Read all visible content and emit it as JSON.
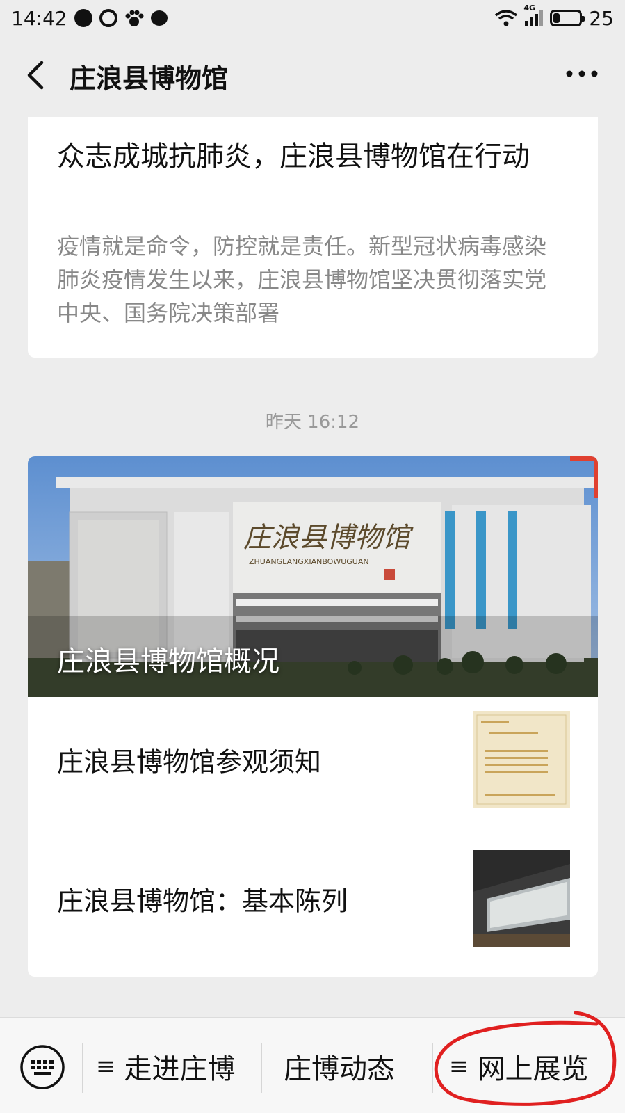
{
  "status_bar": {
    "time": "14:42",
    "left_icons": [
      "message-bubble-icon",
      "app-icon",
      "paw-icon",
      "chat-icon"
    ],
    "network": "4G",
    "battery": "25",
    "battery_level": 0.25
  },
  "header": {
    "title": "庄浪县博物馆",
    "back_icon": "chevron-left-icon",
    "more_icon": "more-dots-icon"
  },
  "article1": {
    "title": "众志成城抗肺炎，庄浪县博物馆在行动",
    "summary": "疫情就是命令，防控就是责任。新型冠状病毒感染肺炎疫情发生以来，庄浪县博物馆坚决贯彻落实党中央、国务院决策部署"
  },
  "timestamp": "昨天 16:12",
  "article_group": {
    "cover": {
      "title": "庄浪县博物馆概况",
      "sign_text": "庄浪县博物馆",
      "sign_pinyin": "ZHUANGLANGXIANBOWUGUAN"
    },
    "items": [
      {
        "title": "庄浪县博物馆参观须知",
        "thumbnail": "visiting-notice-image"
      },
      {
        "title": "庄浪县博物馆：基本陈列",
        "thumbnail": "exhibition-hall-image"
      }
    ]
  },
  "bottom_menu": {
    "keyboard_icon": "keyboard-icon",
    "items": [
      {
        "label": "走进庄博",
        "has_submenu": true
      },
      {
        "label": "庄博动态",
        "has_submenu": false
      },
      {
        "label": "网上展览",
        "has_submenu": true
      }
    ],
    "submenu_icon": "≡",
    "highlight_color": "#e02020"
  }
}
